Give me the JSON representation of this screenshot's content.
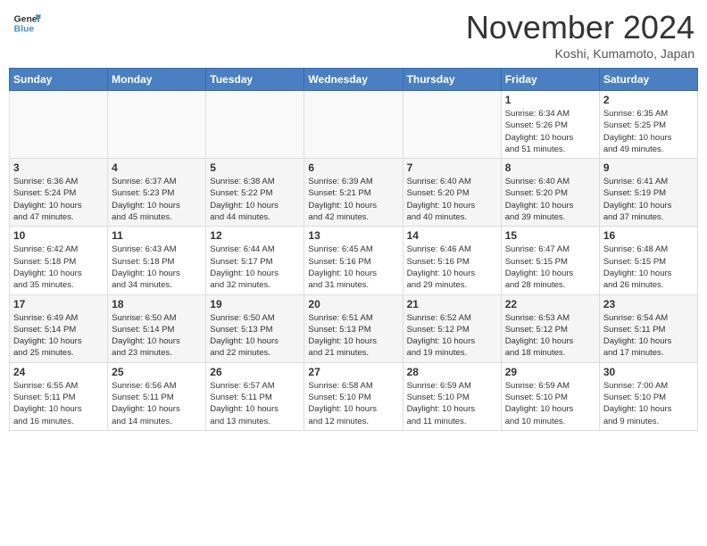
{
  "logo": {
    "general": "General",
    "blue": "Blue"
  },
  "header": {
    "month": "November 2024",
    "location": "Koshi, Kumamoto, Japan"
  },
  "weekdays": [
    "Sunday",
    "Monday",
    "Tuesday",
    "Wednesday",
    "Thursday",
    "Friday",
    "Saturday"
  ],
  "weeks": [
    [
      {
        "day": "",
        "info": ""
      },
      {
        "day": "",
        "info": ""
      },
      {
        "day": "",
        "info": ""
      },
      {
        "day": "",
        "info": ""
      },
      {
        "day": "",
        "info": ""
      },
      {
        "day": "1",
        "info": "Sunrise: 6:34 AM\nSunset: 5:26 PM\nDaylight: 10 hours\nand 51 minutes."
      },
      {
        "day": "2",
        "info": "Sunrise: 6:35 AM\nSunset: 5:25 PM\nDaylight: 10 hours\nand 49 minutes."
      }
    ],
    [
      {
        "day": "3",
        "info": "Sunrise: 6:36 AM\nSunset: 5:24 PM\nDaylight: 10 hours\nand 47 minutes."
      },
      {
        "day": "4",
        "info": "Sunrise: 6:37 AM\nSunset: 5:23 PM\nDaylight: 10 hours\nand 45 minutes."
      },
      {
        "day": "5",
        "info": "Sunrise: 6:38 AM\nSunset: 5:22 PM\nDaylight: 10 hours\nand 44 minutes."
      },
      {
        "day": "6",
        "info": "Sunrise: 6:39 AM\nSunset: 5:21 PM\nDaylight: 10 hours\nand 42 minutes."
      },
      {
        "day": "7",
        "info": "Sunrise: 6:40 AM\nSunset: 5:20 PM\nDaylight: 10 hours\nand 40 minutes."
      },
      {
        "day": "8",
        "info": "Sunrise: 6:40 AM\nSunset: 5:20 PM\nDaylight: 10 hours\nand 39 minutes."
      },
      {
        "day": "9",
        "info": "Sunrise: 6:41 AM\nSunset: 5:19 PM\nDaylight: 10 hours\nand 37 minutes."
      }
    ],
    [
      {
        "day": "10",
        "info": "Sunrise: 6:42 AM\nSunset: 5:18 PM\nDaylight: 10 hours\nand 35 minutes."
      },
      {
        "day": "11",
        "info": "Sunrise: 6:43 AM\nSunset: 5:18 PM\nDaylight: 10 hours\nand 34 minutes."
      },
      {
        "day": "12",
        "info": "Sunrise: 6:44 AM\nSunset: 5:17 PM\nDaylight: 10 hours\nand 32 minutes."
      },
      {
        "day": "13",
        "info": "Sunrise: 6:45 AM\nSunset: 5:16 PM\nDaylight: 10 hours\nand 31 minutes."
      },
      {
        "day": "14",
        "info": "Sunrise: 6:46 AM\nSunset: 5:16 PM\nDaylight: 10 hours\nand 29 minutes."
      },
      {
        "day": "15",
        "info": "Sunrise: 6:47 AM\nSunset: 5:15 PM\nDaylight: 10 hours\nand 28 minutes."
      },
      {
        "day": "16",
        "info": "Sunrise: 6:48 AM\nSunset: 5:15 PM\nDaylight: 10 hours\nand 26 minutes."
      }
    ],
    [
      {
        "day": "17",
        "info": "Sunrise: 6:49 AM\nSunset: 5:14 PM\nDaylight: 10 hours\nand 25 minutes."
      },
      {
        "day": "18",
        "info": "Sunrise: 6:50 AM\nSunset: 5:14 PM\nDaylight: 10 hours\nand 23 minutes."
      },
      {
        "day": "19",
        "info": "Sunrise: 6:50 AM\nSunset: 5:13 PM\nDaylight: 10 hours\nand 22 minutes."
      },
      {
        "day": "20",
        "info": "Sunrise: 6:51 AM\nSunset: 5:13 PM\nDaylight: 10 hours\nand 21 minutes."
      },
      {
        "day": "21",
        "info": "Sunrise: 6:52 AM\nSunset: 5:12 PM\nDaylight: 10 hours\nand 19 minutes."
      },
      {
        "day": "22",
        "info": "Sunrise: 6:53 AM\nSunset: 5:12 PM\nDaylight: 10 hours\nand 18 minutes."
      },
      {
        "day": "23",
        "info": "Sunrise: 6:54 AM\nSunset: 5:11 PM\nDaylight: 10 hours\nand 17 minutes."
      }
    ],
    [
      {
        "day": "24",
        "info": "Sunrise: 6:55 AM\nSunset: 5:11 PM\nDaylight: 10 hours\nand 16 minutes."
      },
      {
        "day": "25",
        "info": "Sunrise: 6:56 AM\nSunset: 5:11 PM\nDaylight: 10 hours\nand 14 minutes."
      },
      {
        "day": "26",
        "info": "Sunrise: 6:57 AM\nSunset: 5:11 PM\nDaylight: 10 hours\nand 13 minutes."
      },
      {
        "day": "27",
        "info": "Sunrise: 6:58 AM\nSunset: 5:10 PM\nDaylight: 10 hours\nand 12 minutes."
      },
      {
        "day": "28",
        "info": "Sunrise: 6:59 AM\nSunset: 5:10 PM\nDaylight: 10 hours\nand 11 minutes."
      },
      {
        "day": "29",
        "info": "Sunrise: 6:59 AM\nSunset: 5:10 PM\nDaylight: 10 hours\nand 10 minutes."
      },
      {
        "day": "30",
        "info": "Sunrise: 7:00 AM\nSunset: 5:10 PM\nDaylight: 10 hours\nand 9 minutes."
      }
    ]
  ]
}
